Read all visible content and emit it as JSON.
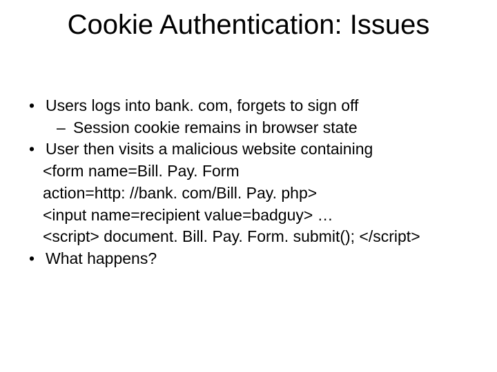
{
  "title": "Cookie Authentication: Issues",
  "lines": {
    "l1": "Users logs into bank. com, forgets to sign off",
    "l2": "Session cookie remains in browser state",
    "l3": "User then visits a malicious website containing",
    "c1": "<form  name=Bill. Pay. Form",
    "c2": "action=http: //bank. com/Bill. Pay. php>",
    "c3": "<input  name=recipient  value=badguy> …",
    "c4": "<script> document. Bill. Pay. Form. submit(); </script>",
    "l4": "What happens?"
  }
}
